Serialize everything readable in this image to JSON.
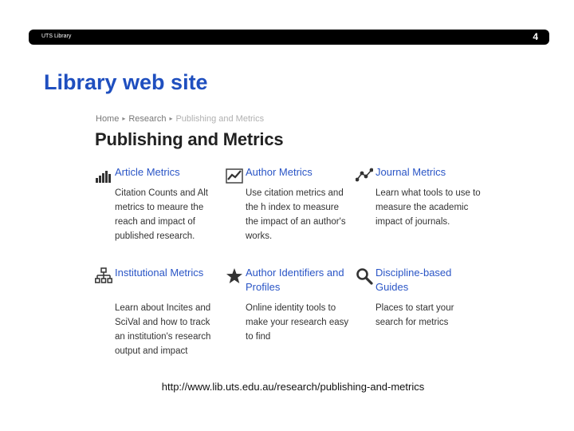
{
  "header": {
    "label": "UTS Library",
    "slide_number": "4"
  },
  "slide": {
    "title": "Library web site",
    "url": "http://www.lib.uts.edu.au/research/publishing-and-metrics"
  },
  "screenshot": {
    "breadcrumb": [
      "Home",
      "Research",
      "Publishing and Metrics"
    ],
    "heading": "Publishing and Metrics",
    "cards": [
      {
        "title": "Article Metrics",
        "icon": "bar-chart-icon",
        "description": "Citation Counts and Alt metrics to meaure the reach and impact of published research."
      },
      {
        "title": "Author Metrics",
        "icon": "line-chart-icon",
        "description": "Use citation metrics and the h index to measure the impact of an author's works."
      },
      {
        "title": "Journal Metrics",
        "icon": "scatter-line-icon",
        "description": "Learn what tools to use to measure the academic impact of journals."
      },
      {
        "title": "Institutional Metrics",
        "icon": "hierarchy-icon",
        "description": "Learn about Incites and SciVal and how to track an institution's research output and impact"
      },
      {
        "title": "Author Identifiers and Profiles",
        "icon": "star-icon",
        "description": "Online identity tools to make your research easy to find"
      },
      {
        "title": "Discipline-based Guides",
        "icon": "magnifier-icon",
        "description": "Places to start your search for metrics"
      }
    ]
  },
  "colors": {
    "link": "#2a55c6",
    "title": "#1f4fbf",
    "bar": "#000000"
  }
}
